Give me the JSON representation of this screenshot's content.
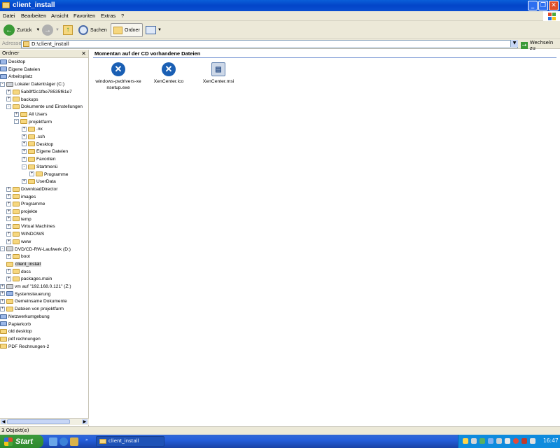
{
  "window": {
    "title": "client_install"
  },
  "menu": [
    "Datei",
    "Bearbeiten",
    "Ansicht",
    "Favoriten",
    "Extras",
    "?"
  ],
  "toolbar": {
    "back": "Zurück",
    "search": "Suchen",
    "folders": "Ordner"
  },
  "address": {
    "label": "Adresse",
    "value": "D:\\client_install",
    "go": "Wechseln zu"
  },
  "left_pane": {
    "title": "Ordner"
  },
  "tree": [
    {
      "label": "Desktop",
      "depth": 0,
      "expander": "",
      "icon": "sys"
    },
    {
      "label": "Eigene Dateien",
      "depth": 0,
      "expander": "",
      "icon": "sys"
    },
    {
      "label": "Arbeitsplatz",
      "depth": 0,
      "expander": "",
      "icon": "sys"
    },
    {
      "label": "Lokaler Datenträger (C:)",
      "depth": 0,
      "expander": "-",
      "icon": "drv"
    },
    {
      "label": "5ab9ff2c1fbe78535f61e7",
      "depth": 1,
      "expander": "+",
      "icon": "folder"
    },
    {
      "label": "backups",
      "depth": 1,
      "expander": "+",
      "icon": "folder"
    },
    {
      "label": "Dokumente und Einstellungen",
      "depth": 1,
      "expander": "-",
      "icon": "folder"
    },
    {
      "label": "All Users",
      "depth": 2,
      "expander": "+",
      "icon": "folder"
    },
    {
      "label": "projektfarm",
      "depth": 2,
      "expander": "-",
      "icon": "folder"
    },
    {
      "label": ".nx",
      "depth": 3,
      "expander": "+",
      "icon": "folder"
    },
    {
      "label": ".ssh",
      "depth": 3,
      "expander": "+",
      "icon": "folder"
    },
    {
      "label": "Desktop",
      "depth": 3,
      "expander": "+",
      "icon": "folder"
    },
    {
      "label": "Eigene Dateien",
      "depth": 3,
      "expander": "+",
      "icon": "folder"
    },
    {
      "label": "Favoriten",
      "depth": 3,
      "expander": "+",
      "icon": "folder"
    },
    {
      "label": "Startmenü",
      "depth": 3,
      "expander": "-",
      "icon": "folder"
    },
    {
      "label": "Programme",
      "depth": 4,
      "expander": "+",
      "icon": "folder"
    },
    {
      "label": "UserData",
      "depth": 3,
      "expander": "+",
      "icon": "folder"
    },
    {
      "label": "DownloadDirector",
      "depth": 1,
      "expander": "+",
      "icon": "folder"
    },
    {
      "label": "images",
      "depth": 1,
      "expander": "+",
      "icon": "folder"
    },
    {
      "label": "Programme",
      "depth": 1,
      "expander": "+",
      "icon": "folder"
    },
    {
      "label": "projekte",
      "depth": 1,
      "expander": "+",
      "icon": "folder"
    },
    {
      "label": "temp",
      "depth": 1,
      "expander": "+",
      "icon": "folder"
    },
    {
      "label": "Virtual Machines",
      "depth": 1,
      "expander": "+",
      "icon": "folder"
    },
    {
      "label": "WINDOWS",
      "depth": 1,
      "expander": "+",
      "icon": "folder"
    },
    {
      "label": "www",
      "depth": 1,
      "expander": "+",
      "icon": "folder"
    },
    {
      "label": "DVD/CD-RW-Laufwerk (D:)",
      "depth": 0,
      "expander": "-",
      "icon": "drv"
    },
    {
      "label": "boot",
      "depth": 1,
      "expander": "+",
      "icon": "folder"
    },
    {
      "label": "client_install",
      "depth": 1,
      "expander": "",
      "icon": "folder",
      "selected": true
    },
    {
      "label": "docs",
      "depth": 1,
      "expander": "+",
      "icon": "folder"
    },
    {
      "label": "packages.main",
      "depth": 1,
      "expander": "+",
      "icon": "folder"
    },
    {
      "label": "vm auf \"192.168.0.121\" (Z:)",
      "depth": 0,
      "expander": "+",
      "icon": "drv"
    },
    {
      "label": "Systemsteuerung",
      "depth": 0,
      "expander": "+",
      "icon": "sys"
    },
    {
      "label": "Gemeinsame Dokumente",
      "depth": 0,
      "expander": "+",
      "icon": "folder"
    },
    {
      "label": "Dateien von projektfarm",
      "depth": 0,
      "expander": "+",
      "icon": "folder"
    },
    {
      "label": "Netzwerkumgebung",
      "depth": 0,
      "expander": "",
      "icon": "sys"
    },
    {
      "label": "Papierkorb",
      "depth": 0,
      "expander": "",
      "icon": "sys"
    },
    {
      "label": "old desktop",
      "depth": 0,
      "expander": "",
      "icon": "folder"
    },
    {
      "label": "pdf rechnungen",
      "depth": 0,
      "expander": "",
      "icon": "folder"
    },
    {
      "label": "PDF Rechnungen-2",
      "depth": 0,
      "expander": "",
      "icon": "folder"
    }
  ],
  "right_pane": {
    "heading": "Momentan auf der CD vorhandene Dateien",
    "files": [
      {
        "name": "windows-pvdrivers-xensetup.exe",
        "line1": "windows-pvdrivers-xe",
        "line2": "nsetup.exe",
        "icon": "xen-icon"
      },
      {
        "name": "XenCenter.ico",
        "line1": "XenCenter.ico",
        "line2": "",
        "icon": "xen-icon"
      },
      {
        "name": "XenCenter.msi",
        "line1": "XenCenter.msi",
        "line2": "",
        "icon": "msi-installer-icon"
      }
    ]
  },
  "status": {
    "text": "3 Objekt(e)"
  },
  "taskbar": {
    "start": "Start",
    "task": "client_install",
    "clock": "16:47"
  },
  "colors": {
    "titlebar": "#0a5fd8",
    "start": "#3a9a36",
    "tray": "#0f8bdd"
  }
}
